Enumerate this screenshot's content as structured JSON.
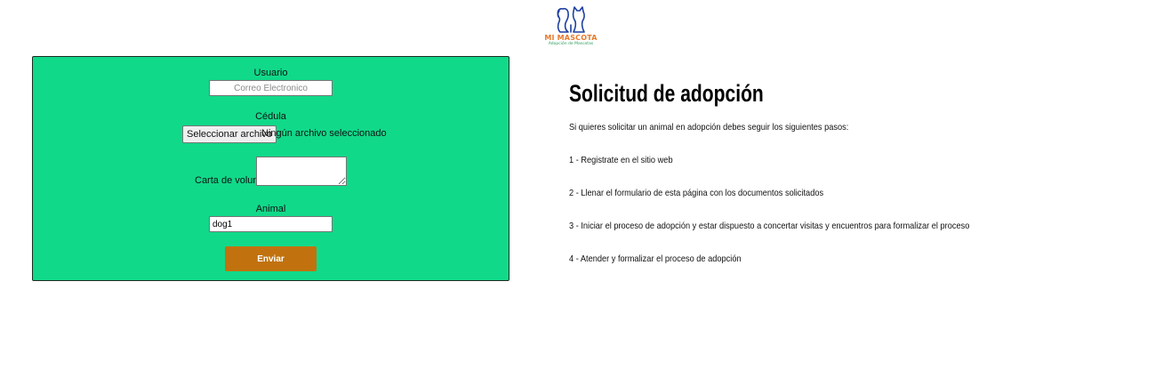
{
  "logo": {
    "title": "MI MASCOTA",
    "subtitle": "Adopción de Mascotas",
    "icon": "dog-cat-icon",
    "colors": {
      "outline": "#1d3ea0",
      "title": "#e8792a",
      "subtitle": "#2a9d5b"
    }
  },
  "form": {
    "background": "#11d98a",
    "usuario_label": "Usuario",
    "usuario_placeholder": "Correo Electronico",
    "cedula_label": "Cédula",
    "file_button_label": "Seleccionar archivo",
    "file_status": "Ningún archivo seleccionado",
    "carta_label": "Carta de voluntad",
    "animal_label": "Animal",
    "animal_value": "dog1",
    "submit_label": "Enviar",
    "submit_color": "#c1720e"
  },
  "info": {
    "title": "Solicitud de adopción",
    "intro": "Si quieres solicitar un animal en adopción debes seguir los siguientes pasos:",
    "steps": [
      "1 - Registrate en el sitio web",
      "2 - Llenar el formulario de esta página con los documentos solicitados",
      "3 - Iniciar el proceso de adopción y estar dispuesto a concertar visitas y encuentros para formalizar el proceso",
      "4 - Atender y formalizar el proceso de adopción"
    ]
  }
}
